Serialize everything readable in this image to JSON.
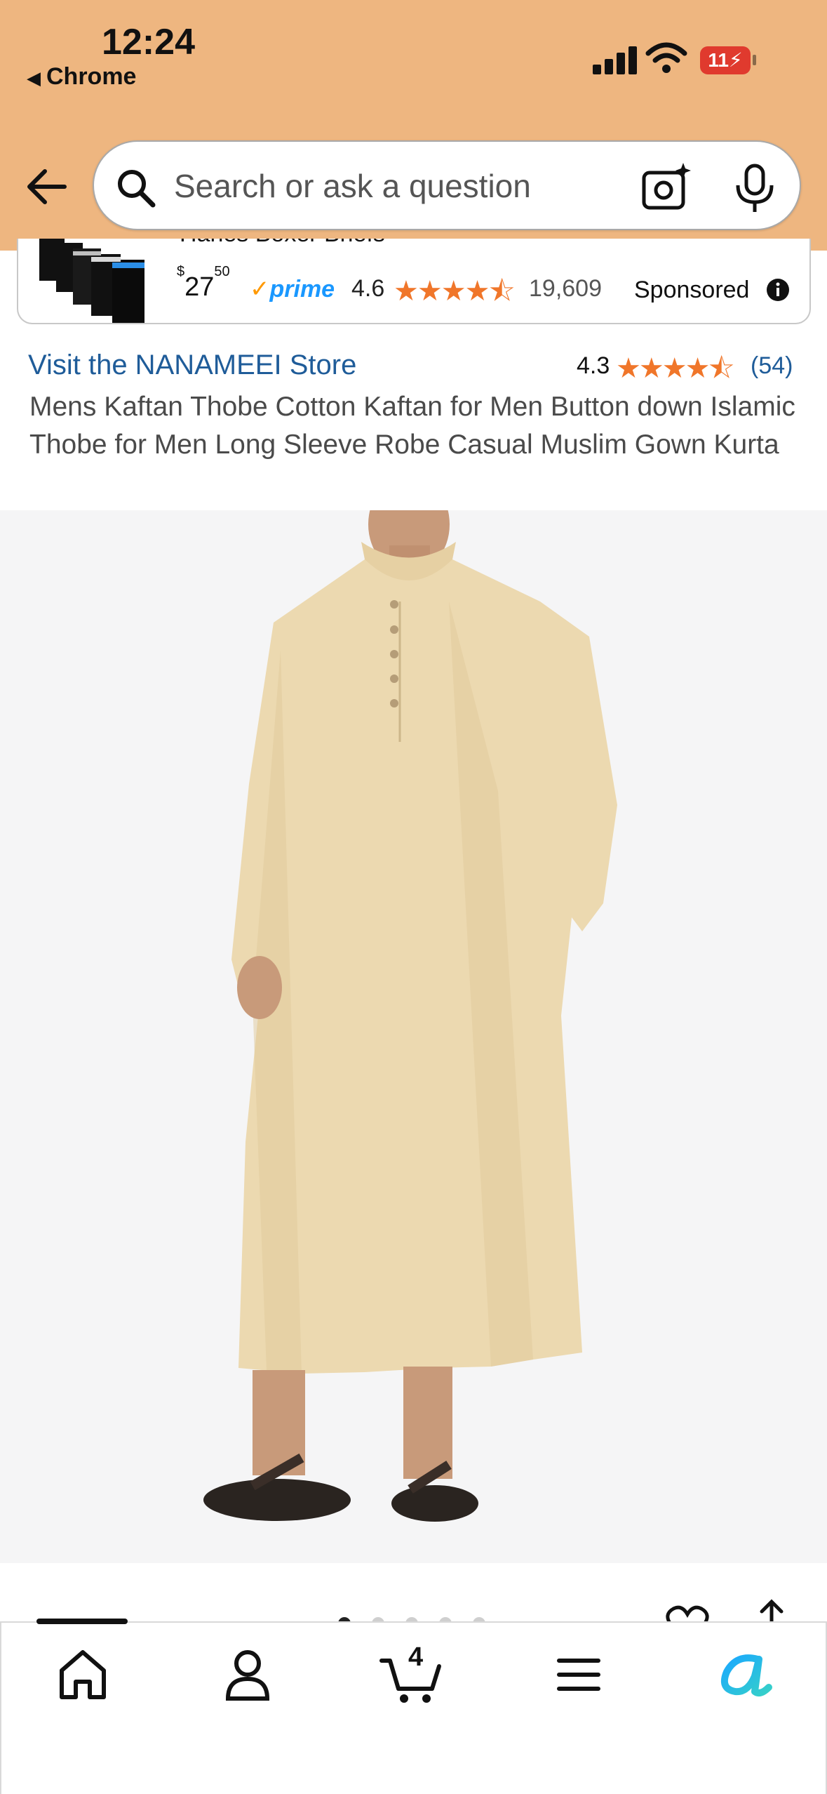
{
  "status_bar": {
    "time": "12:24",
    "back_app": "Chrome",
    "battery": "11"
  },
  "search": {
    "placeholder": "Search or ask a question"
  },
  "ad": {
    "partial_title": "Hanes Boxer Briefs",
    "price_symbol": "$",
    "price_whole": "27",
    "price_fraction": "50",
    "prime_label": "prime",
    "rating": "4.6",
    "stars": 4.5,
    "review_count": "19,609",
    "sponsored_label": "Sponsored"
  },
  "product": {
    "store_link": "Visit the NANAMEEI Store",
    "rating": "4.3",
    "stars": 4.5,
    "review_count": "(54)",
    "title": "Mens Kaftan Thobe Cotton Kaftan for Men Button down Islamic Thobe for Men Long Sleeve Robe Casual Muslim Gown Kurta",
    "image_count": 5,
    "image_index": 1
  },
  "tabbar": {
    "cart_count": "4"
  },
  "colors": {
    "header_bg": "#eeb680",
    "link": "#1f5c99",
    "star": "#f0762a",
    "prime": "#1a98ff",
    "robe": "#ecd9b0"
  },
  "icons": [
    "back-arrow-icon",
    "search-icon",
    "camera-icon",
    "mic-icon",
    "info-icon",
    "heart-icon",
    "share-icon",
    "home-icon",
    "account-icon",
    "cart-icon",
    "menu-icon",
    "rufus-icon"
  ]
}
